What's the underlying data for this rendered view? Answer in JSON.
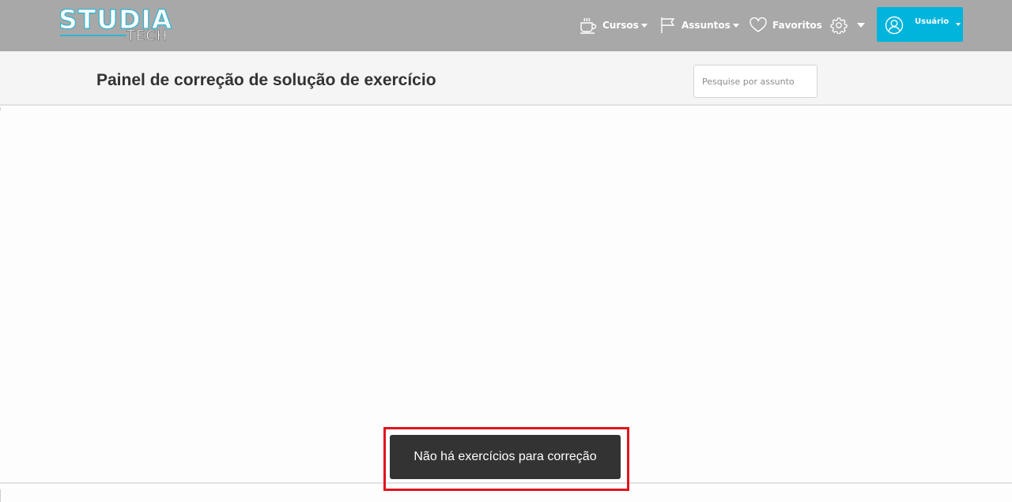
{
  "logo": {
    "main": "STUDIA",
    "sub": "TECH"
  },
  "nav": {
    "cursos": {
      "label": "Cursos",
      "icon": "coffee-cup-icon"
    },
    "assuntos": {
      "label": "Assuntos",
      "icon": "flag-icon"
    },
    "favoritos": {
      "label": "Favoritos",
      "icon": "heart-icon"
    },
    "settings": {
      "icon": "gear-icon"
    },
    "user": {
      "label": "Usuário",
      "icon": "user-circle-icon"
    }
  },
  "page": {
    "title": "Painel de correção de solução de exercício",
    "search_placeholder": "Pesquise por assunto"
  },
  "toast": {
    "message": "Não há exercícios para correção"
  },
  "colors": {
    "topbar": "#a8a8a8",
    "accent": "#00b4dc",
    "highlight": "#e0141e",
    "toast_bg": "#333333"
  }
}
